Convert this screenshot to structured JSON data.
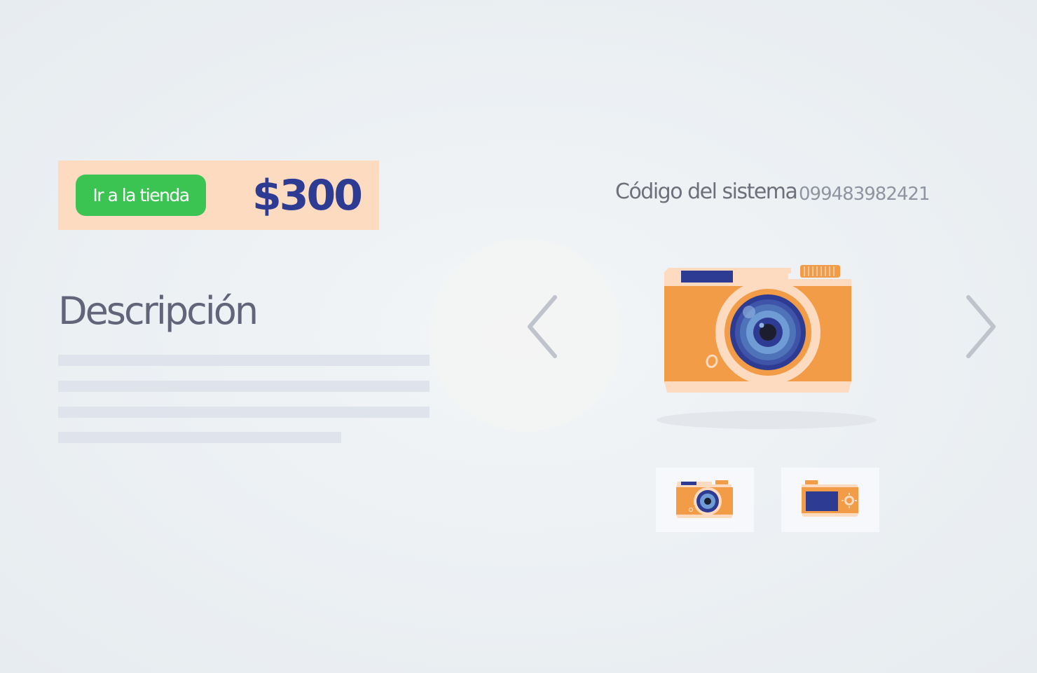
{
  "product": {
    "store_button_label": "Ir a la tienda",
    "price": "$300",
    "description_title": "Descripción",
    "system_code_label": "Código del sistema",
    "system_code_value": "099483982421"
  },
  "gallery": {
    "prev_icon": "chevron-left-icon",
    "next_icon": "chevron-right-icon",
    "main_image_icon": "camera-front-icon",
    "thumbnails": [
      {
        "icon": "camera-front-icon"
      },
      {
        "icon": "camera-back-icon"
      }
    ]
  },
  "colors": {
    "accent_green": "#3cc453",
    "price_blue": "#2e3b92",
    "price_bar_bg": "#fddbc0",
    "camera_orange": "#f39c48"
  }
}
